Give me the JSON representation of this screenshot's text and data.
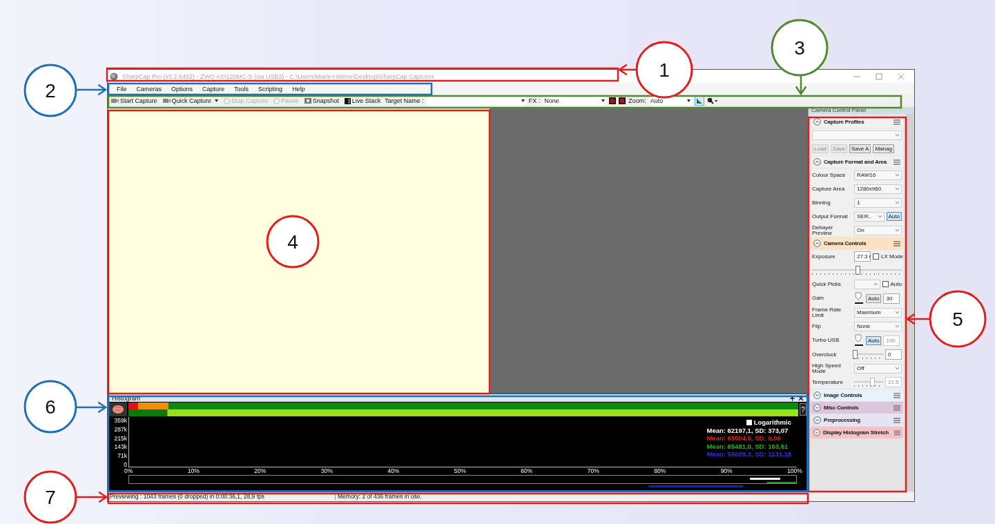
{
  "window": {
    "title": "SharpCap Pro (v3.2.6452) - ZWO ASI120MC-S (via USB3) - C:\\Users\\Marie-Hélène\\Desktop\\SharpCap Captures"
  },
  "menu": [
    "File",
    "Cameras",
    "Options",
    "Capture",
    "Tools",
    "Scripting",
    "Help"
  ],
  "toolbar": [
    {
      "kind": "button",
      "label": "Start Capture",
      "disabled": false,
      "dropdown": false
    },
    {
      "kind": "button",
      "label": "Quick Capture",
      "disabled": false,
      "dropdown": true
    },
    {
      "kind": "button",
      "label": "Stop Capture",
      "disabled": true,
      "dropdown": false
    },
    {
      "kind": "button",
      "label": "Pause",
      "disabled": true,
      "dropdown": false
    },
    {
      "kind": "button",
      "label": "Snapshot",
      "disabled": false,
      "dropdown": false
    },
    {
      "kind": "button",
      "label": "Live Stack",
      "disabled": false,
      "dropdown": false
    },
    {
      "kind": "label",
      "label": "Target Name :"
    },
    {
      "kind": "combo"
    },
    {
      "kind": "label",
      "label": "FX :"
    },
    {
      "kind": "combo",
      "value": "None"
    },
    {
      "kind": "swatch"
    },
    {
      "kind": "swatch"
    },
    {
      "kind": "label",
      "label": "Zoom:"
    },
    {
      "kind": "combo",
      "value": "Auto"
    },
    {
      "kind": "toggle",
      "selected": true
    },
    {
      "kind": "magnifier"
    }
  ],
  "panel": {
    "title": "Camera Control Panel",
    "sections": [
      {
        "title": "Capture Profiles",
        "expanded": true,
        "color": "#f0f0f0",
        "rows": [
          {
            "controls": [
              {
                "kind": "select"
              }
            ]
          },
          {
            "controls": [
              {
                "kind": "button",
                "label": "Load",
                "disabled": true,
                "selected": false
              },
              {
                "kind": "button",
                "label": "Save",
                "disabled": true,
                "selected": false
              },
              {
                "kind": "button",
                "label": "Save A",
                "disabled": false,
                "selected": false
              },
              {
                "kind": "button",
                "label": "Manag",
                "disabled": false,
                "selected": false
              }
            ]
          }
        ]
      },
      {
        "title": "Capture Format and Area",
        "expanded": true,
        "color": "#f0f0f0",
        "rows": [
          {
            "label": "Colour Space",
            "controls": [
              {
                "kind": "select",
                "value": "RAW16"
              }
            ]
          },
          {
            "label": "Capture Area",
            "controls": [
              {
                "kind": "select",
                "value": "1280x960"
              }
            ]
          },
          {
            "label": "Binning",
            "controls": [
              {
                "kind": "select",
                "value": "1"
              }
            ]
          },
          {
            "label": "Output Format",
            "controls": [
              {
                "kind": "select",
                "value": "SER.."
              },
              {
                "kind": "button",
                "label": "Auto",
                "disabled": false,
                "selected": true
              }
            ]
          },
          {
            "label": "Debayer Preview",
            "controls": [
              {
                "kind": "select",
                "value": "On"
              }
            ]
          }
        ]
      },
      {
        "title": "Camera Controls",
        "expanded": true,
        "color": "#fbe3c4",
        "rows": [
          {
            "label": "Exposure",
            "controls": [
              {
                "kind": "field",
                "value": "27.3 r",
                "disabled": false
              },
              {
                "kind": "checkbox",
                "label": "LX Mode",
                "checked": false
              }
            ]
          },
          {
            "controls": [
              {
                "kind": "slider",
                "level": 0.5,
                "disabled": false
              }
            ]
          },
          {
            "label": "Quick Picks",
            "controls": [
              {
                "kind": "select"
              },
              {
                "kind": "checkbox",
                "label": "Auto",
                "checked": false
              }
            ]
          },
          {
            "label": "Gain",
            "controls": [
              {
                "kind": "knob"
              },
              {
                "kind": "button",
                "label": "Auto",
                "disabled": false,
                "selected": false
              },
              {
                "kind": "field",
                "value": "30",
                "disabled": false
              }
            ]
          },
          {
            "label": "Frame Rate Limit",
            "controls": [
              {
                "kind": "select",
                "value": "Maximum"
              }
            ]
          },
          {
            "label": "Flip",
            "controls": [
              {
                "kind": "select",
                "value": "None"
              }
            ]
          },
          {
            "label": "Turbo USB",
            "controls": [
              {
                "kind": "knob"
              },
              {
                "kind": "button",
                "label": "Auto",
                "disabled": false,
                "selected": true
              },
              {
                "kind": "field",
                "value": "100",
                "disabled": true
              }
            ]
          },
          {
            "label": "Overclock",
            "controls": [
              {
                "kind": "slider",
                "level": 0,
                "disabled": false
              },
              {
                "kind": "field",
                "value": "0",
                "disabled": false
              }
            ]
          },
          {
            "label": "High Speed Mode",
            "controls": [
              {
                "kind": "select",
                "value": "Off"
              }
            ]
          },
          {
            "label": "Temperature",
            "controls": [
              {
                "kind": "slider",
                "level": 0.6,
                "disabled": true
              },
              {
                "kind": "field",
                "value": "21.5",
                "disabled": true
              }
            ]
          }
        ]
      },
      {
        "title": "Image Controls",
        "expanded": false,
        "color": "#e6f3fb"
      },
      {
        "title": "Misc Controls",
        "expanded": false,
        "color": "#dcc6dc"
      },
      {
        "title": "Preprocessing",
        "expanded": false,
        "color": "#e4e4f4"
      },
      {
        "title": "Display Histogram Stretch",
        "expanded": false,
        "color": "#f2c4c8"
      }
    ]
  },
  "histogram": {
    "title": "Histogram",
    "help": "?",
    "yticks": [
      "359k",
      "287k",
      "215k",
      "143k",
      "71k",
      "0"
    ],
    "xticks": [
      "0%",
      "10%",
      "20%",
      "30%",
      "40%",
      "50%",
      "60%",
      "70%",
      "80%",
      "90%",
      "100%"
    ],
    "logarithmic": {
      "label": "Logarithmic",
      "checked": false
    },
    "stats": [
      {
        "text": "Mean: 62197,1, SD: 373,07",
        "color": "#ffffff"
      },
      {
        "text": "Mean: 65504,0, SD: 0,00",
        "color": "#e02020"
      },
      {
        "text": "Mean: 65481,0, SD: 163,61",
        "color": "#20b020"
      },
      {
        "text": "Mean: 55609,3, SD: 1133,18",
        "color": "#3030e0"
      }
    ]
  },
  "status_bar": [
    "Previewing : 1043 frames (0 dropped) in 0:00:36,1, 28,9 fps",
    "Memory: 2 of 436 frames in use."
  ],
  "annotations": [
    {
      "number": "1",
      "color": "#e31c1c"
    },
    {
      "number": "2",
      "color": "#1f6fb8"
    },
    {
      "number": "3",
      "color": "#4f8a2c"
    },
    {
      "number": "4",
      "color": "#e31c1c"
    },
    {
      "number": "5",
      "color": "#e31c1c"
    },
    {
      "number": "6",
      "color": "#1f6fb8"
    },
    {
      "number": "7",
      "color": "#e31c1c"
    }
  ]
}
